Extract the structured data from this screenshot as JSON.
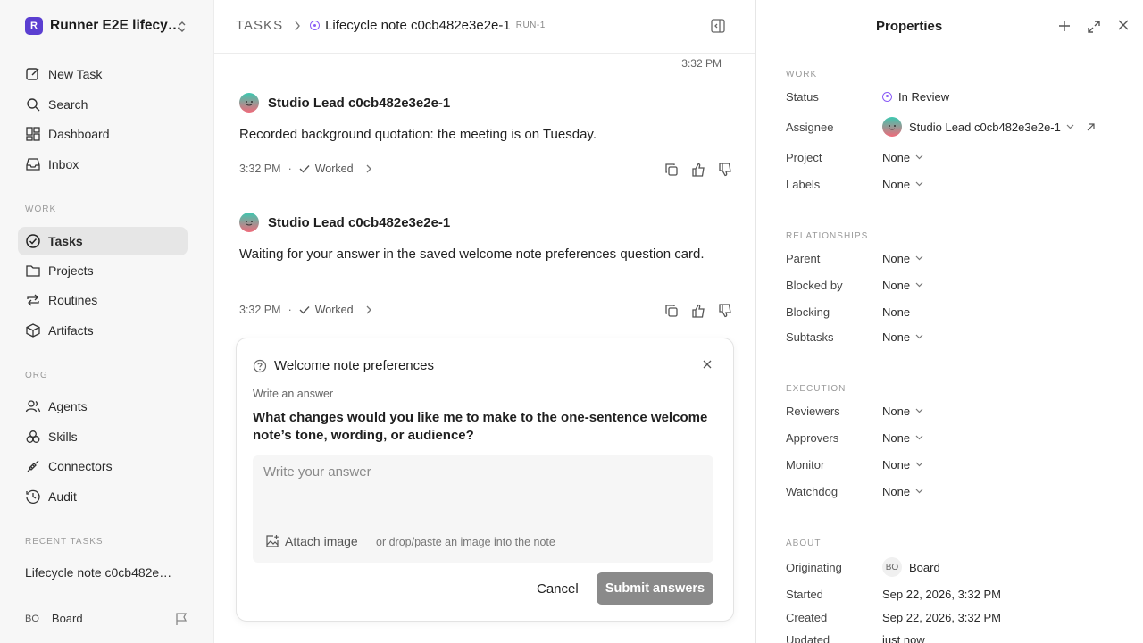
{
  "workspace": {
    "logo_letter": "R",
    "name": "Runner E2E lifecy…"
  },
  "nav": {
    "new_task": "New Task",
    "search": "Search",
    "dashboard": "Dashboard",
    "inbox": "Inbox"
  },
  "sections": {
    "work": "WORK",
    "org": "ORG",
    "recent": "RECENT TASKS"
  },
  "work_items": {
    "tasks": "Tasks",
    "projects": "Projects",
    "routines": "Routines",
    "artifacts": "Artifacts"
  },
  "org_items": {
    "agents": "Agents",
    "skills": "Skills",
    "connectors": "Connectors",
    "audit": "Audit"
  },
  "recent_task": "Lifecycle note c0cb482e…",
  "user": {
    "initials": "BO",
    "name": "Board"
  },
  "breadcrumb": {
    "tasks": "TASKS",
    "title": "Lifecycle note c0cb482e3e2e-1",
    "run": "RUN-1"
  },
  "thread": {
    "top_time": "3:32 PM",
    "messages": [
      {
        "author": "Studio Lead c0cb482e3e2e-1",
        "body": "Recorded background quotation: the meeting is on Tuesday.",
        "time": "3:32 PM",
        "dot": "·",
        "status": "Worked"
      },
      {
        "author": "Studio Lead c0cb482e3e2e-1",
        "body": "Waiting for your answer in the saved welcome note preferences question card.",
        "time": "3:32 PM",
        "dot": "·",
        "status": "Worked"
      }
    ]
  },
  "question_card": {
    "title": "Welcome note preferences",
    "subtitle": "Write an answer",
    "question": "What changes would you like me to make to the one-sentence welcome note’s tone, wording, or audience?",
    "placeholder": "Write your answer",
    "attach_label": "Attach image",
    "attach_hint": "or drop/paste an image into the note",
    "cancel": "Cancel",
    "submit": "Submit answers"
  },
  "properties": {
    "title": "Properties",
    "sections": {
      "work": "WORK",
      "relationships": "RELATIONSHIPS",
      "execution": "EXECUTION",
      "about": "ABOUT"
    },
    "labels": {
      "status": "Status",
      "assignee": "Assignee",
      "project": "Project",
      "labels": "Labels",
      "parent": "Parent",
      "blocked_by": "Blocked by",
      "blocking": "Blocking",
      "subtasks": "Subtasks",
      "reviewers": "Reviewers",
      "approvers": "Approvers",
      "monitor": "Monitor",
      "watchdog": "Watchdog",
      "originating": "Originating",
      "started": "Started",
      "created": "Created",
      "updated": "Updated"
    },
    "values": {
      "status": "In Review",
      "assignee": "Studio Lead c0cb482e3e2e-1",
      "project": "None",
      "labels": "None",
      "parent": "None",
      "blocked_by": "None",
      "blocking": "None",
      "subtasks": "None",
      "reviewers": "None",
      "approvers": "None",
      "monitor": "None",
      "watchdog": "None",
      "originating_initials": "BO",
      "originating": "Board",
      "started": "Sep 22, 2026, 3:32 PM",
      "created": "Sep 22, 2026, 3:32 PM",
      "updated": "just now"
    }
  },
  "colors": {
    "accent": "#5b3fd1",
    "status_in_review": "#8b5cf6",
    "submit_bg": "#8a8a8a",
    "active_nav": "#e6e6e6"
  }
}
